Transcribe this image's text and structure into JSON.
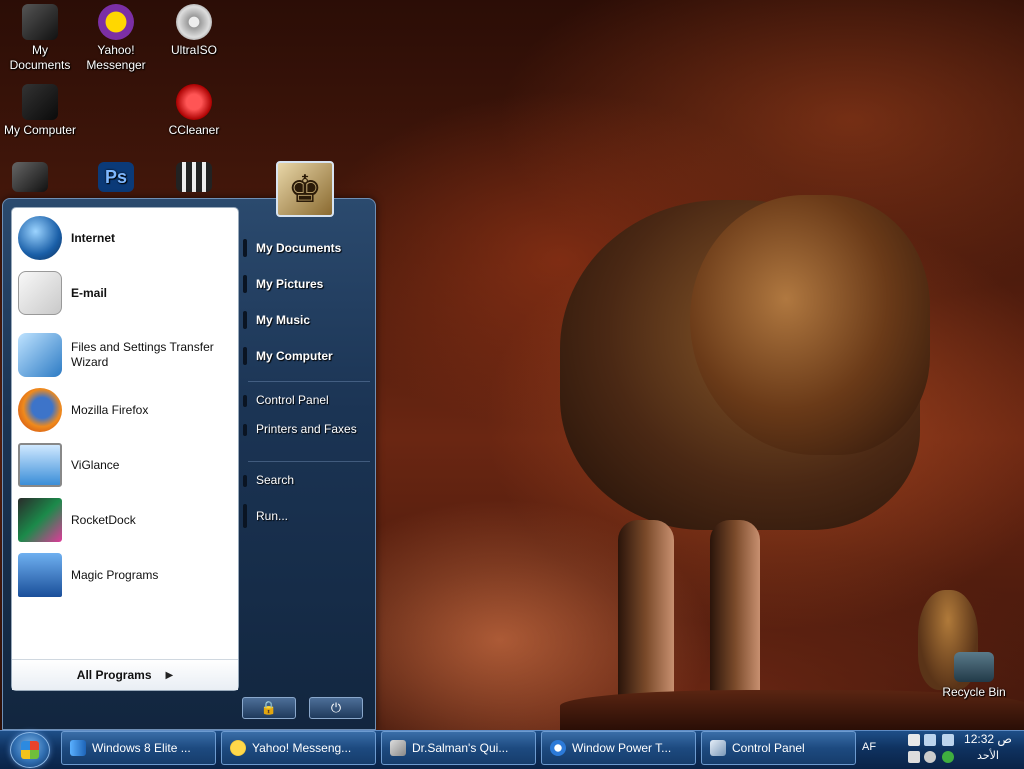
{
  "desktop": {
    "icons": [
      {
        "label": "My\nDocuments",
        "icon": "my-documents-icon"
      },
      {
        "label": "Yahoo!\nMessenger",
        "icon": "yahoo-messenger-icon"
      },
      {
        "label": "UltraISO",
        "icon": "ultraiso-icon"
      },
      {
        "label": "My Computer",
        "icon": "my-computer-icon"
      },
      {
        "label": "CCleaner",
        "icon": "ccleaner-icon"
      },
      {
        "label": "Recycle Bin",
        "icon": "recycle-bin-icon"
      }
    ],
    "partial_icons": [
      "media-player-icon",
      "photoshop-icon",
      "video-editor-icon"
    ]
  },
  "start_menu": {
    "pinned": [
      {
        "label": "Internet",
        "icon": "globe-icon"
      },
      {
        "label": "E-mail",
        "icon": "mail-icon"
      }
    ],
    "recent": [
      {
        "label": "Files and Settings Transfer Wizard",
        "icon": "transfer-wizard-icon"
      },
      {
        "label": "Mozilla Firefox",
        "icon": "firefox-icon"
      },
      {
        "label": "ViGlance",
        "icon": "viglance-icon"
      },
      {
        "label": "RocketDock",
        "icon": "rocketdock-icon"
      },
      {
        "label": "Magic Programs",
        "icon": "magic-programs-icon"
      }
    ],
    "all_programs": "All Programs",
    "places": [
      "My Documents",
      "My Pictures",
      "My Music",
      "My Computer"
    ],
    "settings": [
      "Control Panel",
      "Printers and Faxes"
    ],
    "actions": [
      "Search",
      "Run..."
    ],
    "lock_icon": "lock-icon",
    "power_icon": "power-icon"
  },
  "taskbar": {
    "buttons": [
      {
        "label": "Windows 8 Elite ...",
        "icon": "signal-icon"
      },
      {
        "label": "Yahoo! Messeng...",
        "icon": "yahoo-smiley-icon"
      },
      {
        "label": "Dr.Salman's Qui...",
        "icon": "quick-app-icon"
      },
      {
        "label": "Window Power T...",
        "icon": "power-tools-icon"
      },
      {
        "label": "Control Panel",
        "icon": "control-panel-icon"
      }
    ],
    "language": "AF",
    "clock_time": "12:32 ص",
    "clock_day": "الأحد"
  }
}
